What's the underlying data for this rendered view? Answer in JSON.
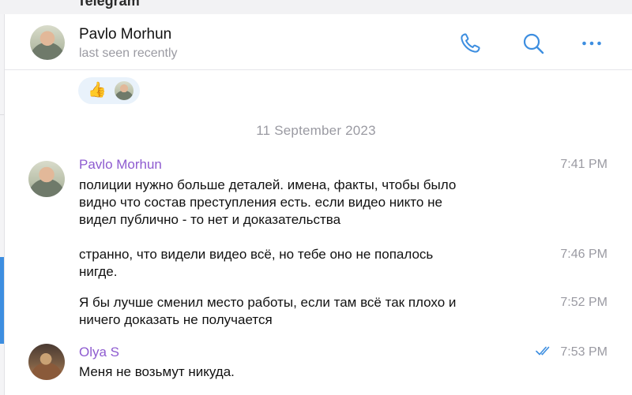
{
  "app": {
    "name": "Telegram"
  },
  "header": {
    "name": "Pavlo Morhun",
    "status": "last seen recently",
    "icons": [
      "phone-icon",
      "search-icon",
      "more-icon"
    ]
  },
  "reaction": {
    "emoji": "👍"
  },
  "date_separator": "11 September 2023",
  "messages": [
    {
      "sender": "Pavlo Morhun",
      "text_lines": [
        "полиции нужно больше деталей. имена, факты, чтобы было",
        "видно что состав преступления есть. если видео никто не",
        "видел публично - то нет и доказательства"
      ],
      "time": "7:41 PM"
    },
    {
      "text_lines": [
        "странно, что видели видео всё, но тебе оно не попалось",
        "нигде."
      ],
      "time": "7:46 PM"
    },
    {
      "text_lines": [
        "Я бы лучше сменил место работы, если там всё так плохо и",
        "ничего доказать не получается"
      ],
      "time": "7:52 PM"
    },
    {
      "sender": "Olya S",
      "text_lines": [
        "Меня не возьмут никуда."
      ],
      "time": "7:53 PM",
      "read": true
    }
  ],
  "colors": {
    "accent": "#3d8ee0",
    "sender": "#8e5bd0",
    "muted": "#9a9aa2",
    "reaction_bg": "#e9f2fb"
  }
}
